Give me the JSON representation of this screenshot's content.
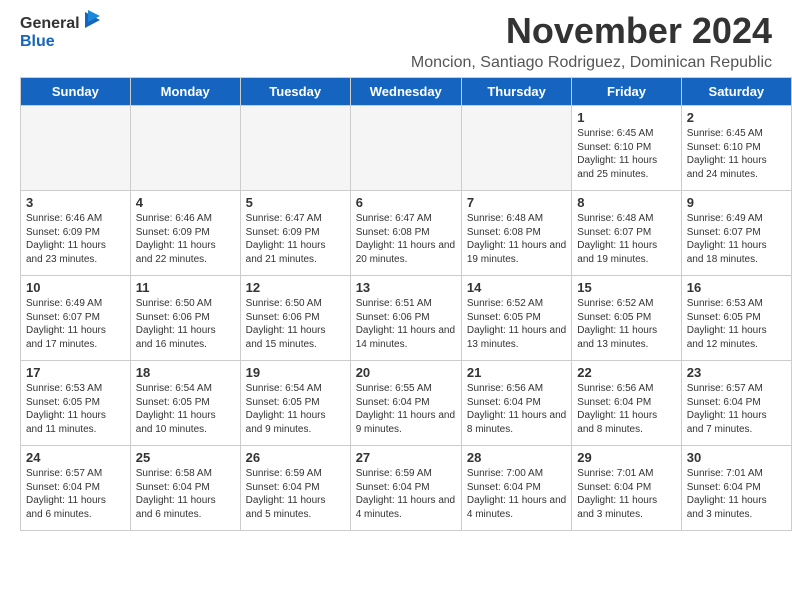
{
  "header": {
    "logo_general": "General",
    "logo_blue": "Blue",
    "month_title": "November 2024",
    "location": "Moncion, Santiago Rodriguez, Dominican Republic"
  },
  "days_of_week": [
    "Sunday",
    "Monday",
    "Tuesday",
    "Wednesday",
    "Thursday",
    "Friday",
    "Saturday"
  ],
  "weeks": [
    [
      {
        "day": "",
        "empty": true
      },
      {
        "day": "",
        "empty": true
      },
      {
        "day": "",
        "empty": true
      },
      {
        "day": "",
        "empty": true
      },
      {
        "day": "",
        "empty": true
      },
      {
        "day": "1",
        "sunrise": "Sunrise: 6:45 AM",
        "sunset": "Sunset: 6:10 PM",
        "daylight": "Daylight: 11 hours and 25 minutes."
      },
      {
        "day": "2",
        "sunrise": "Sunrise: 6:45 AM",
        "sunset": "Sunset: 6:10 PM",
        "daylight": "Daylight: 11 hours and 24 minutes."
      }
    ],
    [
      {
        "day": "3",
        "sunrise": "Sunrise: 6:46 AM",
        "sunset": "Sunset: 6:09 PM",
        "daylight": "Daylight: 11 hours and 23 minutes."
      },
      {
        "day": "4",
        "sunrise": "Sunrise: 6:46 AM",
        "sunset": "Sunset: 6:09 PM",
        "daylight": "Daylight: 11 hours and 22 minutes."
      },
      {
        "day": "5",
        "sunrise": "Sunrise: 6:47 AM",
        "sunset": "Sunset: 6:09 PM",
        "daylight": "Daylight: 11 hours and 21 minutes."
      },
      {
        "day": "6",
        "sunrise": "Sunrise: 6:47 AM",
        "sunset": "Sunset: 6:08 PM",
        "daylight": "Daylight: 11 hours and 20 minutes."
      },
      {
        "day": "7",
        "sunrise": "Sunrise: 6:48 AM",
        "sunset": "Sunset: 6:08 PM",
        "daylight": "Daylight: 11 hours and 19 minutes."
      },
      {
        "day": "8",
        "sunrise": "Sunrise: 6:48 AM",
        "sunset": "Sunset: 6:07 PM",
        "daylight": "Daylight: 11 hours and 19 minutes."
      },
      {
        "day": "9",
        "sunrise": "Sunrise: 6:49 AM",
        "sunset": "Sunset: 6:07 PM",
        "daylight": "Daylight: 11 hours and 18 minutes."
      }
    ],
    [
      {
        "day": "10",
        "sunrise": "Sunrise: 6:49 AM",
        "sunset": "Sunset: 6:07 PM",
        "daylight": "Daylight: 11 hours and 17 minutes."
      },
      {
        "day": "11",
        "sunrise": "Sunrise: 6:50 AM",
        "sunset": "Sunset: 6:06 PM",
        "daylight": "Daylight: 11 hours and 16 minutes."
      },
      {
        "day": "12",
        "sunrise": "Sunrise: 6:50 AM",
        "sunset": "Sunset: 6:06 PM",
        "daylight": "Daylight: 11 hours and 15 minutes."
      },
      {
        "day": "13",
        "sunrise": "Sunrise: 6:51 AM",
        "sunset": "Sunset: 6:06 PM",
        "daylight": "Daylight: 11 hours and 14 minutes."
      },
      {
        "day": "14",
        "sunrise": "Sunrise: 6:52 AM",
        "sunset": "Sunset: 6:05 PM",
        "daylight": "Daylight: 11 hours and 13 minutes."
      },
      {
        "day": "15",
        "sunrise": "Sunrise: 6:52 AM",
        "sunset": "Sunset: 6:05 PM",
        "daylight": "Daylight: 11 hours and 13 minutes."
      },
      {
        "day": "16",
        "sunrise": "Sunrise: 6:53 AM",
        "sunset": "Sunset: 6:05 PM",
        "daylight": "Daylight: 11 hours and 12 minutes."
      }
    ],
    [
      {
        "day": "17",
        "sunrise": "Sunrise: 6:53 AM",
        "sunset": "Sunset: 6:05 PM",
        "daylight": "Daylight: 11 hours and 11 minutes."
      },
      {
        "day": "18",
        "sunrise": "Sunrise: 6:54 AM",
        "sunset": "Sunset: 6:05 PM",
        "daylight": "Daylight: 11 hours and 10 minutes."
      },
      {
        "day": "19",
        "sunrise": "Sunrise: 6:54 AM",
        "sunset": "Sunset: 6:05 PM",
        "daylight": "Daylight: 11 hours and 9 minutes."
      },
      {
        "day": "20",
        "sunrise": "Sunrise: 6:55 AM",
        "sunset": "Sunset: 6:04 PM",
        "daylight": "Daylight: 11 hours and 9 minutes."
      },
      {
        "day": "21",
        "sunrise": "Sunrise: 6:56 AM",
        "sunset": "Sunset: 6:04 PM",
        "daylight": "Daylight: 11 hours and 8 minutes."
      },
      {
        "day": "22",
        "sunrise": "Sunrise: 6:56 AM",
        "sunset": "Sunset: 6:04 PM",
        "daylight": "Daylight: 11 hours and 8 minutes."
      },
      {
        "day": "23",
        "sunrise": "Sunrise: 6:57 AM",
        "sunset": "Sunset: 6:04 PM",
        "daylight": "Daylight: 11 hours and 7 minutes."
      }
    ],
    [
      {
        "day": "24",
        "sunrise": "Sunrise: 6:57 AM",
        "sunset": "Sunset: 6:04 PM",
        "daylight": "Daylight: 11 hours and 6 minutes."
      },
      {
        "day": "25",
        "sunrise": "Sunrise: 6:58 AM",
        "sunset": "Sunset: 6:04 PM",
        "daylight": "Daylight: 11 hours and 6 minutes."
      },
      {
        "day": "26",
        "sunrise": "Sunrise: 6:59 AM",
        "sunset": "Sunset: 6:04 PM",
        "daylight": "Daylight: 11 hours and 5 minutes."
      },
      {
        "day": "27",
        "sunrise": "Sunrise: 6:59 AM",
        "sunset": "Sunset: 6:04 PM",
        "daylight": "Daylight: 11 hours and 4 minutes."
      },
      {
        "day": "28",
        "sunrise": "Sunrise: 7:00 AM",
        "sunset": "Sunset: 6:04 PM",
        "daylight": "Daylight: 11 hours and 4 minutes."
      },
      {
        "day": "29",
        "sunrise": "Sunrise: 7:01 AM",
        "sunset": "Sunset: 6:04 PM",
        "daylight": "Daylight: 11 hours and 3 minutes."
      },
      {
        "day": "30",
        "sunrise": "Sunrise: 7:01 AM",
        "sunset": "Sunset: 6:04 PM",
        "daylight": "Daylight: 11 hours and 3 minutes."
      }
    ]
  ]
}
